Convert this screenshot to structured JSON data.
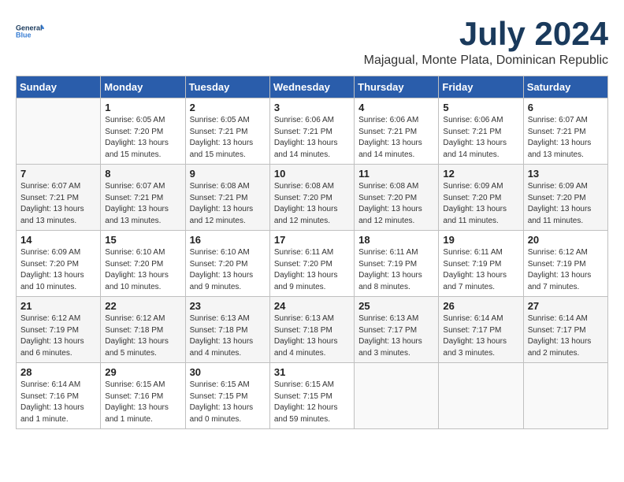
{
  "logo": {
    "line1": "General",
    "line2": "Blue"
  },
  "title": "July 2024",
  "location": "Majagual, Monte Plata, Dominican Republic",
  "days_header": [
    "Sunday",
    "Monday",
    "Tuesday",
    "Wednesday",
    "Thursday",
    "Friday",
    "Saturday"
  ],
  "weeks": [
    [
      {
        "day": "",
        "content": ""
      },
      {
        "day": "1",
        "content": "Sunrise: 6:05 AM\nSunset: 7:20 PM\nDaylight: 13 hours\nand 15 minutes."
      },
      {
        "day": "2",
        "content": "Sunrise: 6:05 AM\nSunset: 7:21 PM\nDaylight: 13 hours\nand 15 minutes."
      },
      {
        "day": "3",
        "content": "Sunrise: 6:06 AM\nSunset: 7:21 PM\nDaylight: 13 hours\nand 14 minutes."
      },
      {
        "day": "4",
        "content": "Sunrise: 6:06 AM\nSunset: 7:21 PM\nDaylight: 13 hours\nand 14 minutes."
      },
      {
        "day": "5",
        "content": "Sunrise: 6:06 AM\nSunset: 7:21 PM\nDaylight: 13 hours\nand 14 minutes."
      },
      {
        "day": "6",
        "content": "Sunrise: 6:07 AM\nSunset: 7:21 PM\nDaylight: 13 hours\nand 13 minutes."
      }
    ],
    [
      {
        "day": "7",
        "content": "Sunrise: 6:07 AM\nSunset: 7:21 PM\nDaylight: 13 hours\nand 13 minutes."
      },
      {
        "day": "8",
        "content": "Sunrise: 6:07 AM\nSunset: 7:21 PM\nDaylight: 13 hours\nand 13 minutes."
      },
      {
        "day": "9",
        "content": "Sunrise: 6:08 AM\nSunset: 7:21 PM\nDaylight: 13 hours\nand 12 minutes."
      },
      {
        "day": "10",
        "content": "Sunrise: 6:08 AM\nSunset: 7:20 PM\nDaylight: 13 hours\nand 12 minutes."
      },
      {
        "day": "11",
        "content": "Sunrise: 6:08 AM\nSunset: 7:20 PM\nDaylight: 13 hours\nand 12 minutes."
      },
      {
        "day": "12",
        "content": "Sunrise: 6:09 AM\nSunset: 7:20 PM\nDaylight: 13 hours\nand 11 minutes."
      },
      {
        "day": "13",
        "content": "Sunrise: 6:09 AM\nSunset: 7:20 PM\nDaylight: 13 hours\nand 11 minutes."
      }
    ],
    [
      {
        "day": "14",
        "content": "Sunrise: 6:09 AM\nSunset: 7:20 PM\nDaylight: 13 hours\nand 10 minutes."
      },
      {
        "day": "15",
        "content": "Sunrise: 6:10 AM\nSunset: 7:20 PM\nDaylight: 13 hours\nand 10 minutes."
      },
      {
        "day": "16",
        "content": "Sunrise: 6:10 AM\nSunset: 7:20 PM\nDaylight: 13 hours\nand 9 minutes."
      },
      {
        "day": "17",
        "content": "Sunrise: 6:11 AM\nSunset: 7:20 PM\nDaylight: 13 hours\nand 9 minutes."
      },
      {
        "day": "18",
        "content": "Sunrise: 6:11 AM\nSunset: 7:19 PM\nDaylight: 13 hours\nand 8 minutes."
      },
      {
        "day": "19",
        "content": "Sunrise: 6:11 AM\nSunset: 7:19 PM\nDaylight: 13 hours\nand 7 minutes."
      },
      {
        "day": "20",
        "content": "Sunrise: 6:12 AM\nSunset: 7:19 PM\nDaylight: 13 hours\nand 7 minutes."
      }
    ],
    [
      {
        "day": "21",
        "content": "Sunrise: 6:12 AM\nSunset: 7:19 PM\nDaylight: 13 hours\nand 6 minutes."
      },
      {
        "day": "22",
        "content": "Sunrise: 6:12 AM\nSunset: 7:18 PM\nDaylight: 13 hours\nand 5 minutes."
      },
      {
        "day": "23",
        "content": "Sunrise: 6:13 AM\nSunset: 7:18 PM\nDaylight: 13 hours\nand 4 minutes."
      },
      {
        "day": "24",
        "content": "Sunrise: 6:13 AM\nSunset: 7:18 PM\nDaylight: 13 hours\nand 4 minutes."
      },
      {
        "day": "25",
        "content": "Sunrise: 6:13 AM\nSunset: 7:17 PM\nDaylight: 13 hours\nand 3 minutes."
      },
      {
        "day": "26",
        "content": "Sunrise: 6:14 AM\nSunset: 7:17 PM\nDaylight: 13 hours\nand 3 minutes."
      },
      {
        "day": "27",
        "content": "Sunrise: 6:14 AM\nSunset: 7:17 PM\nDaylight: 13 hours\nand 2 minutes."
      }
    ],
    [
      {
        "day": "28",
        "content": "Sunrise: 6:14 AM\nSunset: 7:16 PM\nDaylight: 13 hours\nand 1 minute."
      },
      {
        "day": "29",
        "content": "Sunrise: 6:15 AM\nSunset: 7:16 PM\nDaylight: 13 hours\nand 1 minute."
      },
      {
        "day": "30",
        "content": "Sunrise: 6:15 AM\nSunset: 7:15 PM\nDaylight: 13 hours\nand 0 minutes."
      },
      {
        "day": "31",
        "content": "Sunrise: 6:15 AM\nSunset: 7:15 PM\nDaylight: 12 hours\nand 59 minutes."
      },
      {
        "day": "",
        "content": ""
      },
      {
        "day": "",
        "content": ""
      },
      {
        "day": "",
        "content": ""
      }
    ]
  ]
}
